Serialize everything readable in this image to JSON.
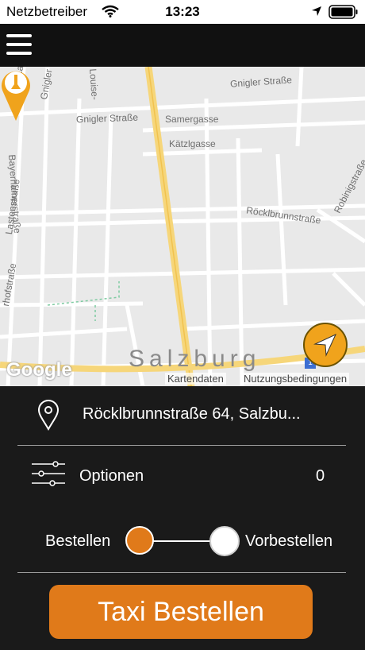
{
  "status_bar": {
    "carrier": "Netzbetreiber",
    "time": "13:23",
    "icons": [
      "wifi-icon",
      "location-arrow-icon",
      "battery-icon"
    ]
  },
  "header": {
    "menu_icon": "hamburger-menu-icon"
  },
  "map": {
    "streets": [
      "Gnigler Straße",
      "Gnigler Straße",
      "Samergasse",
      "Kätzlgasse",
      "Röcklbrunnstraße",
      "Bayerhamerstraße",
      "Lastenstraße",
      "Robinigstraße",
      "Gnigler S",
      "Louise-",
      "Lastenstraße",
      "rhofstraße"
    ],
    "city_label": "Salzburg",
    "logo_text": "Google",
    "attribution_data": "Kartendaten",
    "attribution_terms": "Nutzungsbedingungen",
    "road_number": "1",
    "accent_color": "#f0a31c"
  },
  "panel": {
    "address": "Röcklbrunnstraße 64, Salzbu...",
    "options_label": "Optionen",
    "options_count": "0",
    "toggle_left_label": "Bestellen",
    "toggle_right_label": "Vorbestellen",
    "order_button_label": "Taxi Bestellen",
    "accent_color": "#e07a1a"
  }
}
